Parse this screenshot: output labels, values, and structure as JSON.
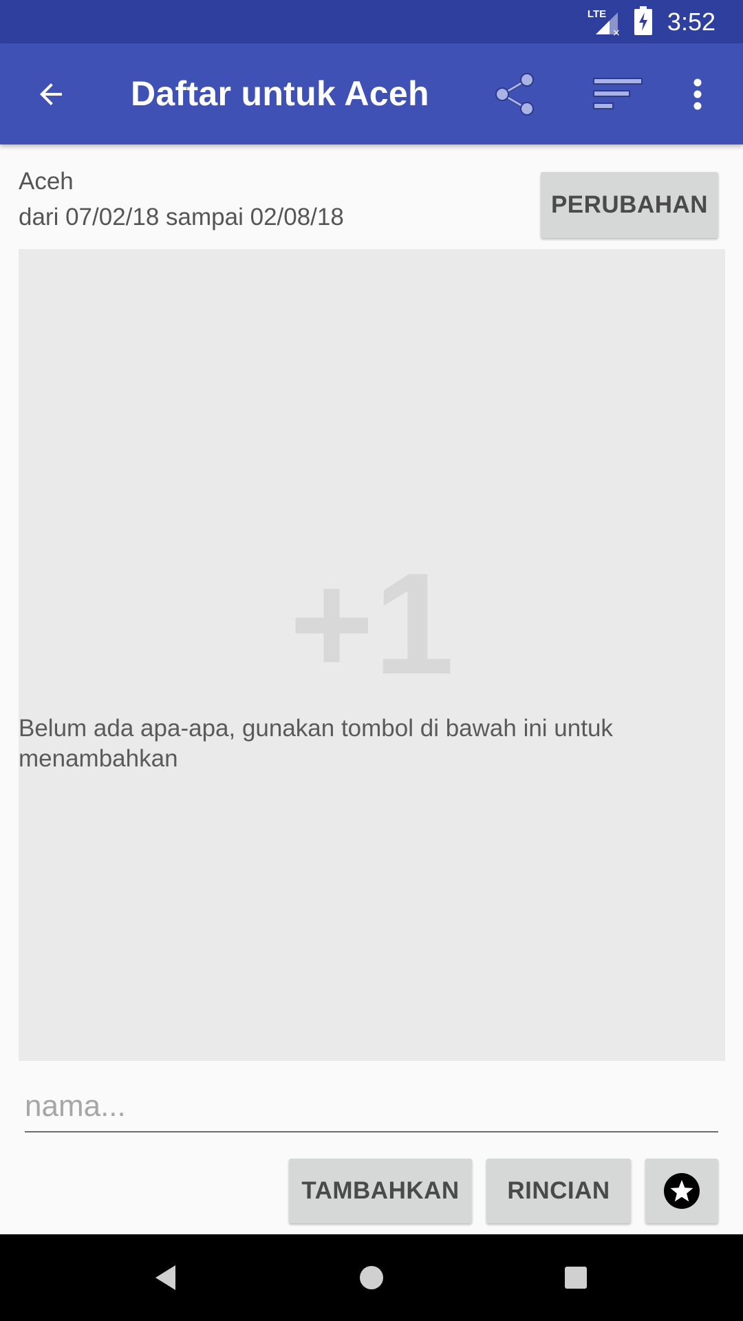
{
  "status_bar": {
    "time": "3:52",
    "network_label": "LTE"
  },
  "app_bar": {
    "title": "Daftar untuk Aceh",
    "icons": [
      "arrow-back-icon",
      "share-icon",
      "sort-icon",
      "more-vert-icon"
    ]
  },
  "info": {
    "region": "Aceh",
    "date_range": "dari 07/02/18 sampai 02/08/18",
    "change_label": "PERUBAHAN"
  },
  "empty_state": {
    "big_text": "+1",
    "message": "Belum ada apa-apa, gunakan tombol di bawah ini untuk menambahkan"
  },
  "input": {
    "value": "",
    "placeholder": "nama..."
  },
  "actions": {
    "add_label": "TAMBAHKAN",
    "details_label": "RINCIAN",
    "favorite_icon": "star-icon"
  },
  "colors": {
    "primary": "#3f51b5",
    "primary_dark": "#2f3f9e",
    "button_bg": "#d6d7d7",
    "empty_bg": "#eaeaea"
  }
}
